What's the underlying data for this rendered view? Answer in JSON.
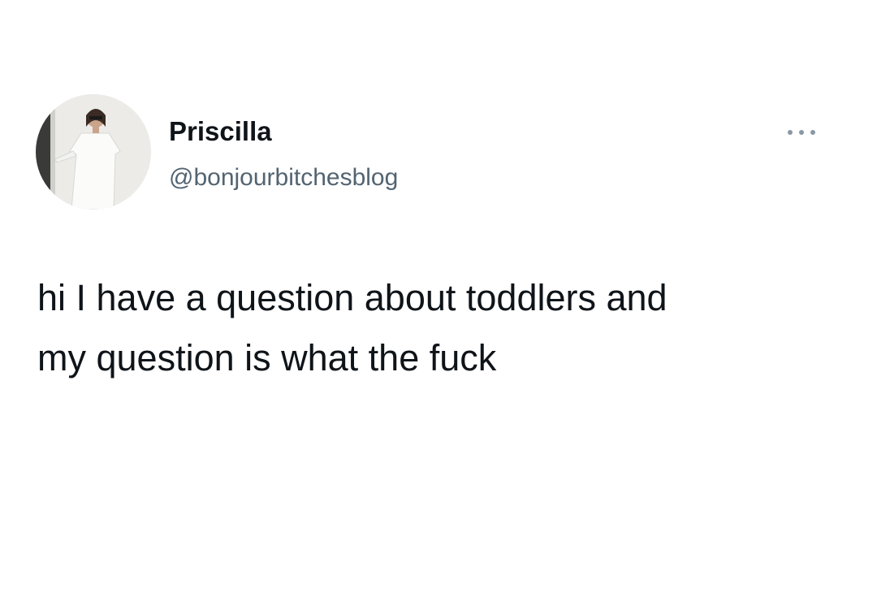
{
  "tweet": {
    "author": {
      "display_name": "Priscilla",
      "handle": "@bonjourbitchesblog",
      "avatar": "profile-photo"
    },
    "more_icon": "more-horizontal-icon",
    "text": "hi I have a question about toddlers and\nmy question is what the fuck"
  },
  "colors": {
    "text": "#0f1419",
    "secondary_text": "#536471",
    "background": "#ffffff"
  }
}
